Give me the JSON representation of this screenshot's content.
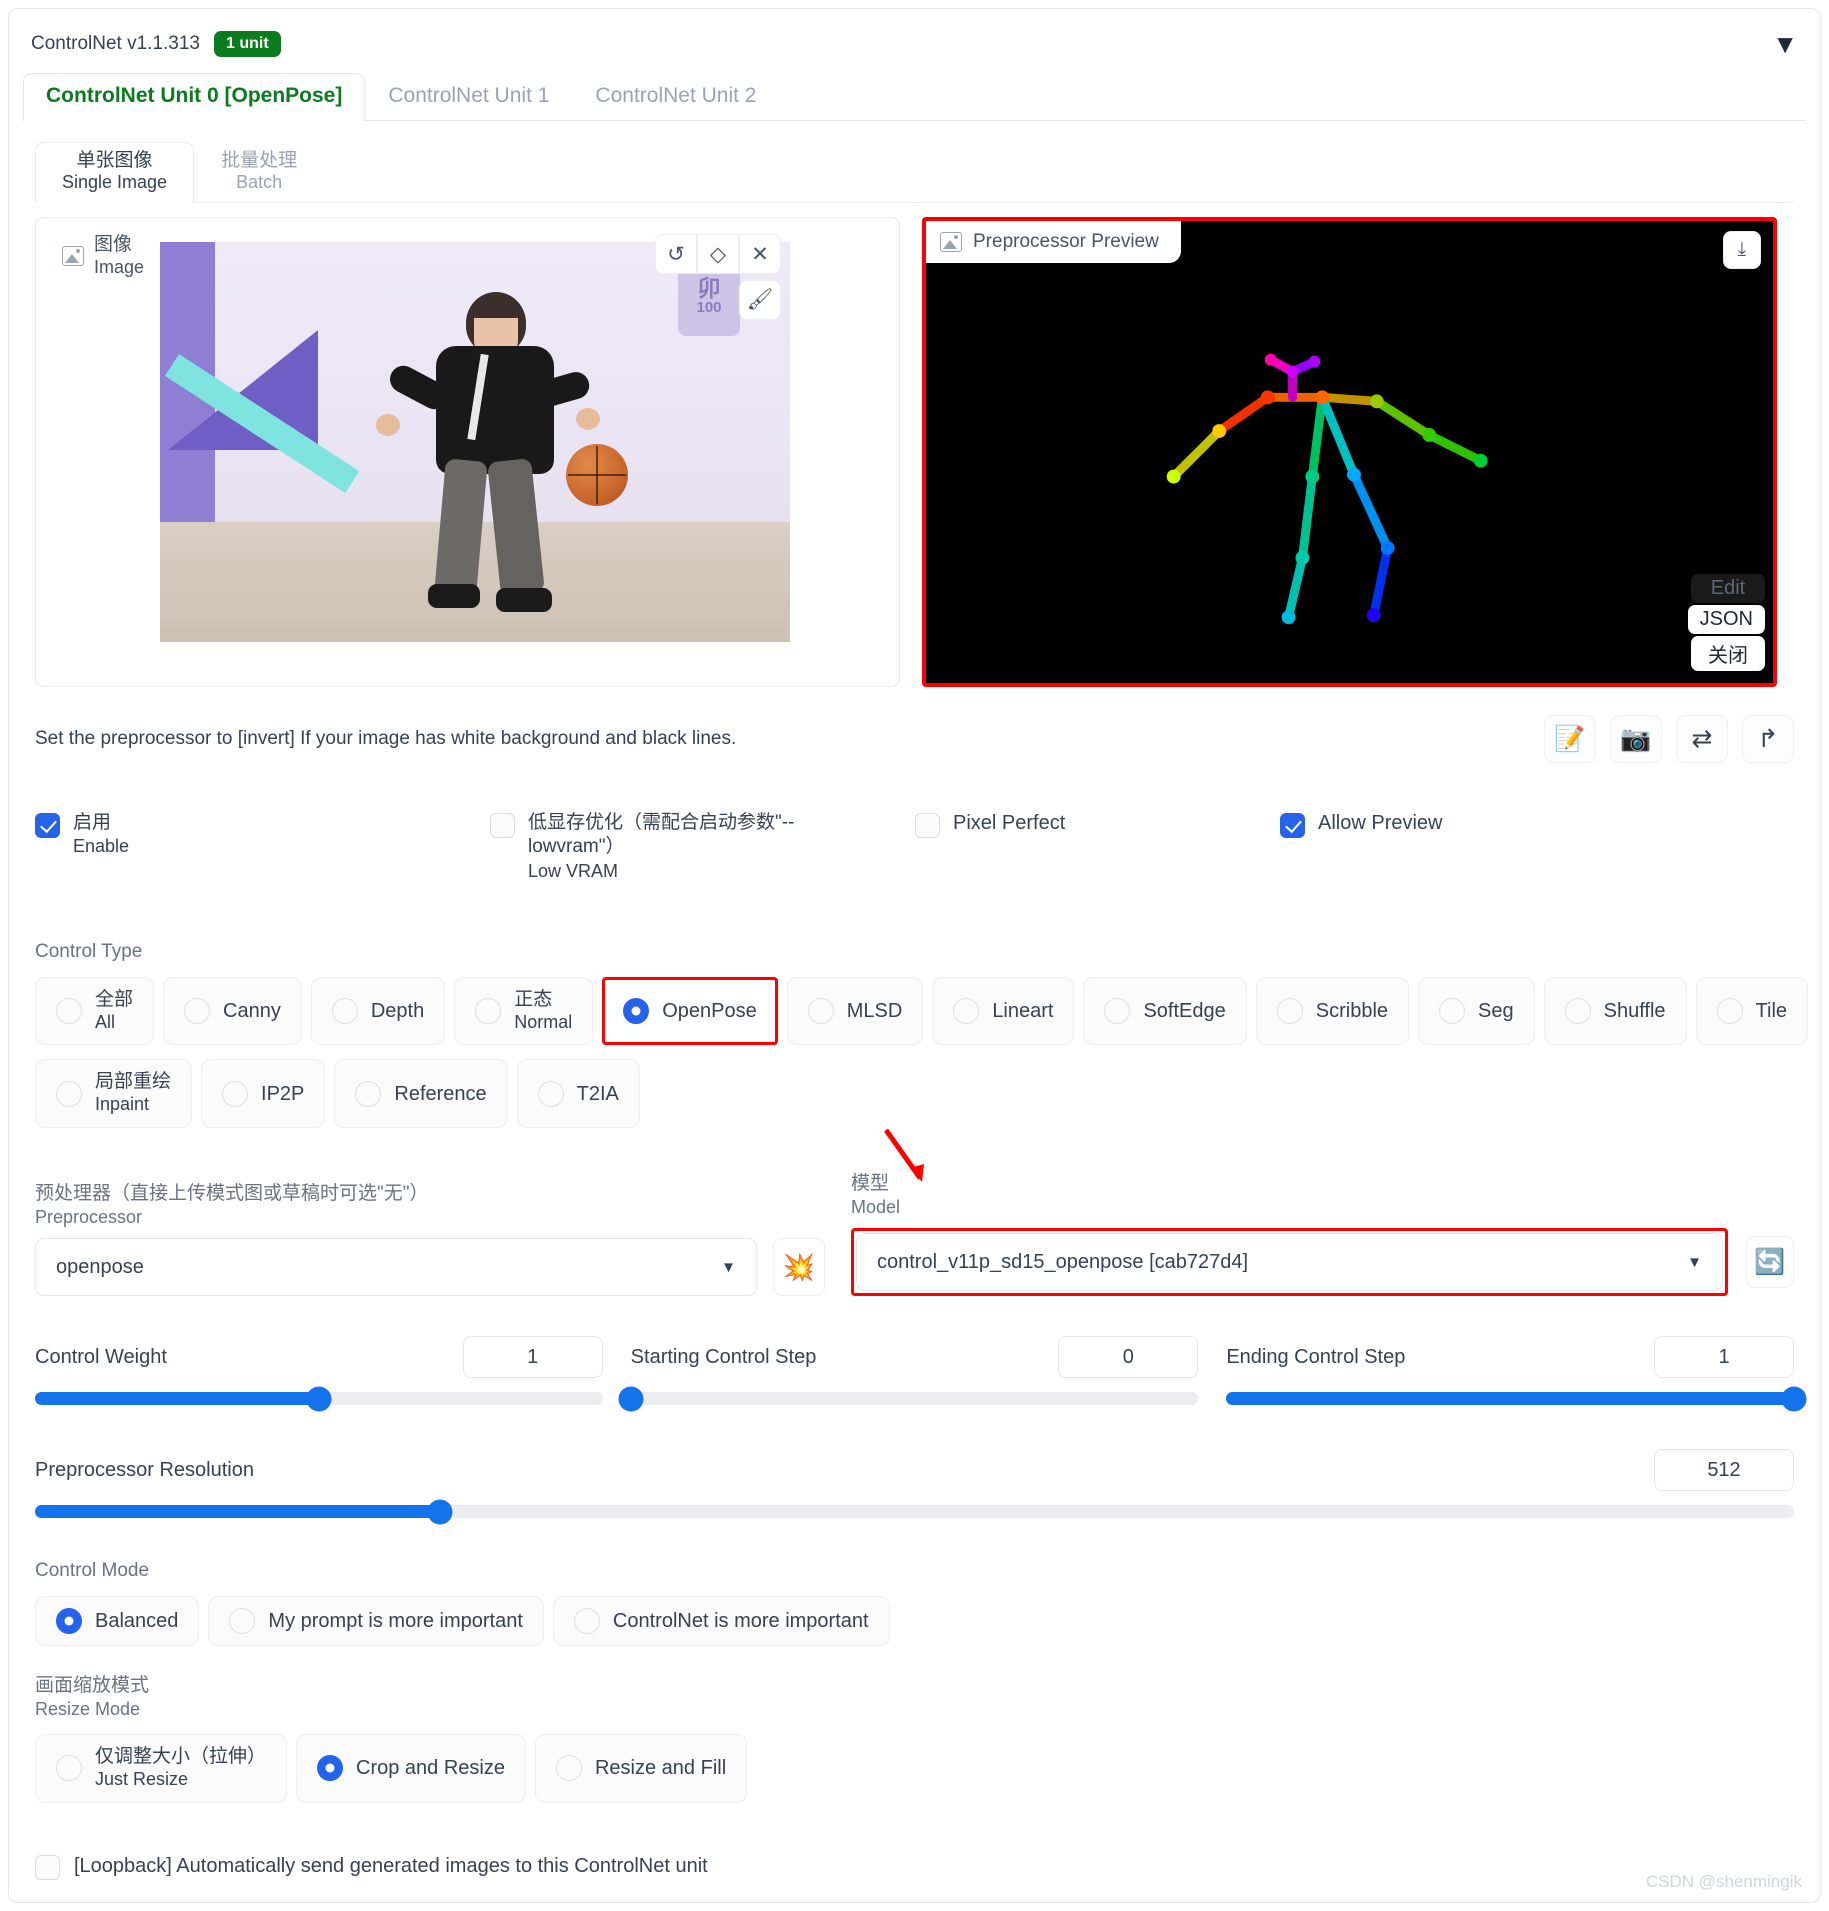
{
  "header": {
    "title": "ControlNet v1.1.313",
    "unit_badge": "1 unit",
    "collapse_icon": "caret-down-icon"
  },
  "unit_tabs": [
    {
      "label": "ControlNet Unit 0 [OpenPose]",
      "active": true
    },
    {
      "label": "ControlNet Unit 1",
      "active": false
    },
    {
      "label": "ControlNet Unit 2",
      "active": false
    }
  ],
  "source_tabs": [
    {
      "cn": "单张图像",
      "en": "Single Image",
      "active": true
    },
    {
      "cn": "批量处理",
      "en": "Batch",
      "active": false
    }
  ],
  "image_panel": {
    "chip_cn": "图像",
    "chip_en": "Image",
    "logo_top": "卯",
    "logo_bottom": "100",
    "tools": [
      {
        "name": "undo-icon",
        "glyph": "↺"
      },
      {
        "name": "eraser-icon",
        "glyph": "◇"
      },
      {
        "name": "close-icon",
        "glyph": "✕"
      }
    ],
    "tool_secondary": {
      "name": "brush-icon",
      "glyph": "🖌"
    }
  },
  "preview_panel": {
    "chip_label": "Preprocessor Preview",
    "chip_icon": "image-icon",
    "download_icon": "download-icon",
    "actions": [
      {
        "label": "Edit",
        "ghost": true
      },
      {
        "label": "JSON",
        "ghost": false
      },
      {
        "label": "关闭",
        "ghost": false
      }
    ]
  },
  "hint": {
    "text": "Set the preprocessor to [invert] If your image has white background and black lines.",
    "icon_actions": [
      {
        "name": "edit-note-icon",
        "glyph": "📝"
      },
      {
        "name": "camera-icon",
        "glyph": "📷"
      },
      {
        "name": "swap-icon",
        "glyph": "⇄"
      },
      {
        "name": "send-icon",
        "glyph": "↱"
      }
    ]
  },
  "checkboxes": [
    {
      "cn": "启用",
      "en": "Enable",
      "checked": true
    },
    {
      "cn": "低显存优化（需配合启动参数\"--lowvram\"）",
      "en": "Low VRAM",
      "checked": false
    },
    {
      "en": "Pixel Perfect",
      "checked": false,
      "single": true
    },
    {
      "en": "Allow Preview",
      "checked": true,
      "single": true
    }
  ],
  "control_type": {
    "label": "Control Type",
    "row1": [
      {
        "cn": "全部",
        "en": "All",
        "selected": false
      },
      {
        "en": "Canny",
        "selected": false,
        "single": true
      },
      {
        "en": "Depth",
        "selected": false,
        "single": true
      },
      {
        "cn": "正态",
        "en": "Normal",
        "selected": false
      },
      {
        "en": "OpenPose",
        "selected": true,
        "single": true,
        "highlight": true
      },
      {
        "en": "MLSD",
        "selected": false,
        "single": true
      },
      {
        "en": "Lineart",
        "selected": false,
        "single": true
      },
      {
        "en": "SoftEdge",
        "selected": false,
        "single": true
      },
      {
        "en": "Scribble",
        "selected": false,
        "single": true
      },
      {
        "en": "Seg",
        "selected": false,
        "single": true
      },
      {
        "en": "Shuffle",
        "selected": false,
        "single": true
      },
      {
        "en": "Tile",
        "selected": false,
        "single": true
      }
    ],
    "row2": [
      {
        "cn": "局部重绘",
        "en": "Inpaint",
        "selected": false
      },
      {
        "en": "IP2P",
        "selected": false,
        "single": true
      },
      {
        "en": "Reference",
        "selected": false,
        "single": true
      },
      {
        "en": "T2IA",
        "selected": false,
        "single": true
      }
    ]
  },
  "preprocessor": {
    "label_cn": "预处理器（直接上传模式图或草稿时可选\"无\"）",
    "label_en": "Preprocessor",
    "value": "openpose",
    "run_icon": "boom-icon",
    "run_glyph": "💥"
  },
  "model": {
    "label_cn": "模型",
    "label_en": "Model",
    "value": "control_v11p_sd15_openpose [cab727d4]",
    "refresh_icon": "refresh-icon",
    "refresh_glyph": "🔄"
  },
  "sliders": [
    {
      "name": "Control Weight",
      "value": "1",
      "percent": 50
    },
    {
      "name": "Starting Control Step",
      "value": "0",
      "percent": 0
    },
    {
      "name": "Ending Control Step",
      "value": "1",
      "percent": 100
    },
    {
      "name": "Preprocessor Resolution",
      "value": "512",
      "percent": 23
    }
  ],
  "control_mode": {
    "label": "Control Mode",
    "options": [
      {
        "en": "Balanced",
        "selected": true
      },
      {
        "en": "My prompt is more important",
        "selected": false
      },
      {
        "en": "ControlNet is more important",
        "selected": false
      }
    ]
  },
  "resize_mode": {
    "label_cn": "画面缩放模式",
    "label_en": "Resize Mode",
    "options": [
      {
        "cn": "仅调整大小（拉伸）",
        "en": "Just Resize",
        "selected": false
      },
      {
        "en": "Crop and Resize",
        "selected": true,
        "single": true
      },
      {
        "en": "Resize and Fill",
        "selected": false,
        "single": true
      }
    ]
  },
  "loopback": {
    "label": "[Loopback] Automatically send generated images to this ControlNet unit",
    "checked": false
  },
  "watermark": "CSDN @shenmingik",
  "colors": {
    "accent_blue": "#2563eb",
    "slider_blue": "#1472ec",
    "annotation_red": "#ff0000",
    "badge_green": "#0a7c1f",
    "active_tab_green": "#0a7c1f"
  }
}
